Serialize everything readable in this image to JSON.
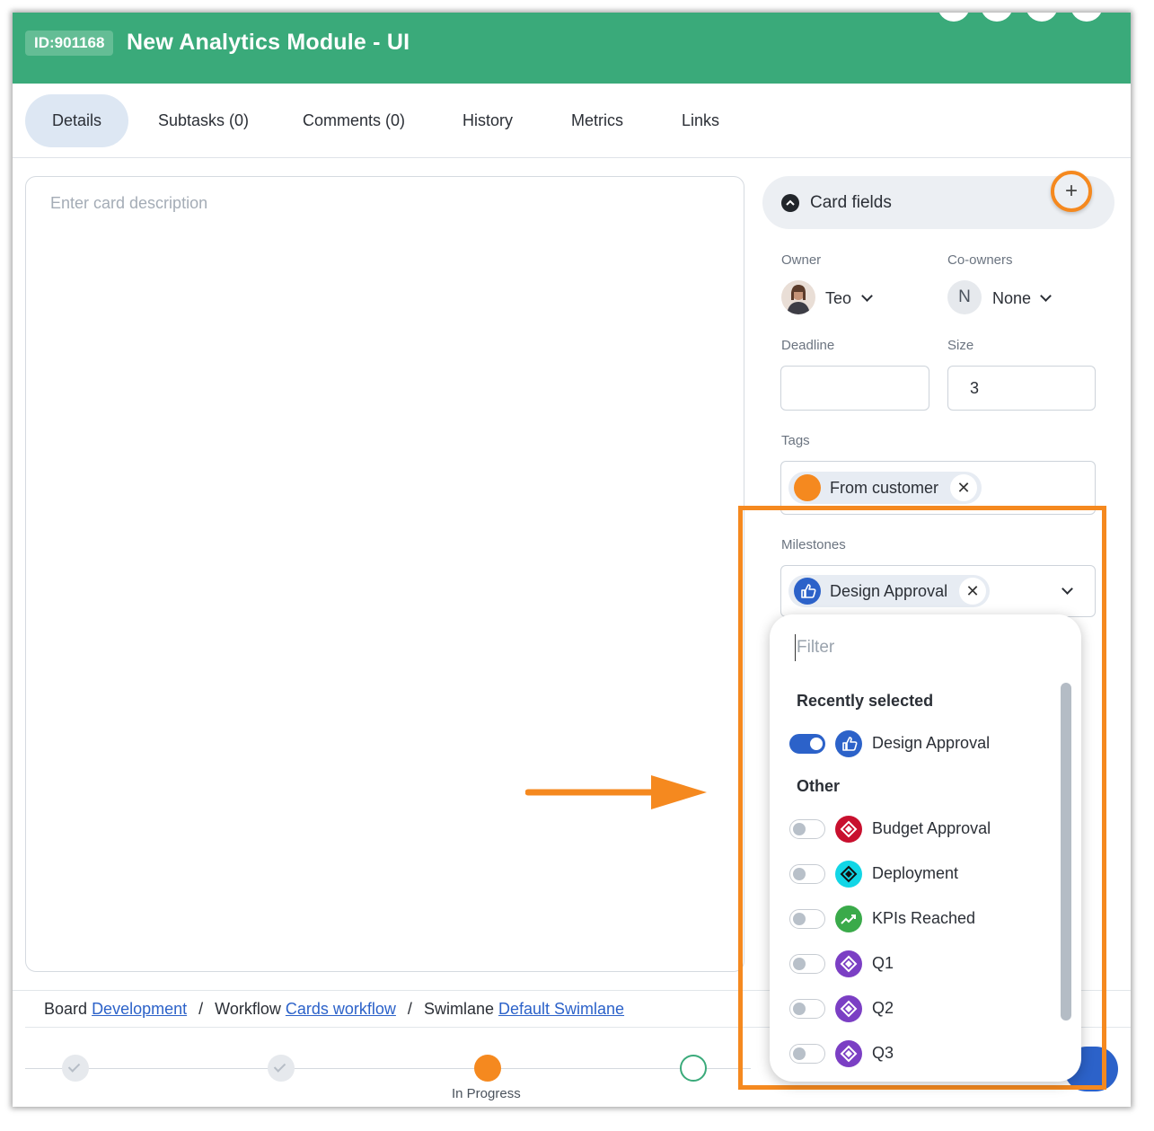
{
  "header": {
    "card_id": "ID:901168",
    "title": "New Analytics Module - UI"
  },
  "tabs": [
    {
      "label": "Details",
      "active": true
    },
    {
      "label": "Subtasks (0)"
    },
    {
      "label": "Comments (0)"
    },
    {
      "label": "History"
    },
    {
      "label": "Metrics"
    },
    {
      "label": "Links"
    }
  ],
  "description": {
    "placeholder": "Enter card description"
  },
  "card_fields": {
    "title": "Card fields",
    "add_symbol": "+",
    "owner": {
      "label": "Owner",
      "value": "Teo"
    },
    "coowners": {
      "label": "Co-owners",
      "avatar_initial": "N",
      "value": "None"
    },
    "deadline": {
      "label": "Deadline",
      "value": ""
    },
    "size": {
      "label": "Size",
      "value": "3"
    },
    "tags": {
      "label": "Tags",
      "items": [
        {
          "text": "From customer",
          "color": "#f5891f"
        }
      ]
    },
    "milestones": {
      "label": "Milestones",
      "selected": [
        {
          "text": "Design Approval",
          "color": "#2c62c9"
        }
      ]
    }
  },
  "milestone_dropdown": {
    "filter_placeholder": "Filter",
    "recent_title": "Recently selected",
    "recent": [
      {
        "label": "Design Approval",
        "on": true,
        "icon": "thumbs-up-icon",
        "color": "#2c62c9"
      }
    ],
    "other_title": "Other",
    "other": [
      {
        "label": "Budget Approval",
        "on": false,
        "icon": "diamond-icon",
        "color": "#c8102e"
      },
      {
        "label": "Deployment",
        "on": false,
        "icon": "diamond-icon",
        "color": "#12d6e6"
      },
      {
        "label": "KPIs Reached",
        "on": false,
        "icon": "trend-up-icon",
        "color": "#3aaa4a"
      },
      {
        "label": "Q1",
        "on": false,
        "icon": "diamond-icon",
        "color": "#7b3fc4"
      },
      {
        "label": "Q2",
        "on": false,
        "icon": "diamond-icon",
        "color": "#7b3fc4"
      },
      {
        "label": "Q3",
        "on": false,
        "icon": "diamond-icon",
        "color": "#7b3fc4"
      }
    ]
  },
  "breadcrumb": {
    "board_label": "Board",
    "board_link": "Development",
    "workflow_label": "Workflow",
    "workflow_link": "Cards workflow",
    "swimlane_label": "Swimlane",
    "swimlane_link": "Default Swimlane",
    "separator": "/"
  },
  "workflow_steps": {
    "current_label": "In Progress"
  },
  "colors": {
    "header": "#3aaa7a",
    "highlight": "#f5891f",
    "accent": "#2c62c9"
  }
}
